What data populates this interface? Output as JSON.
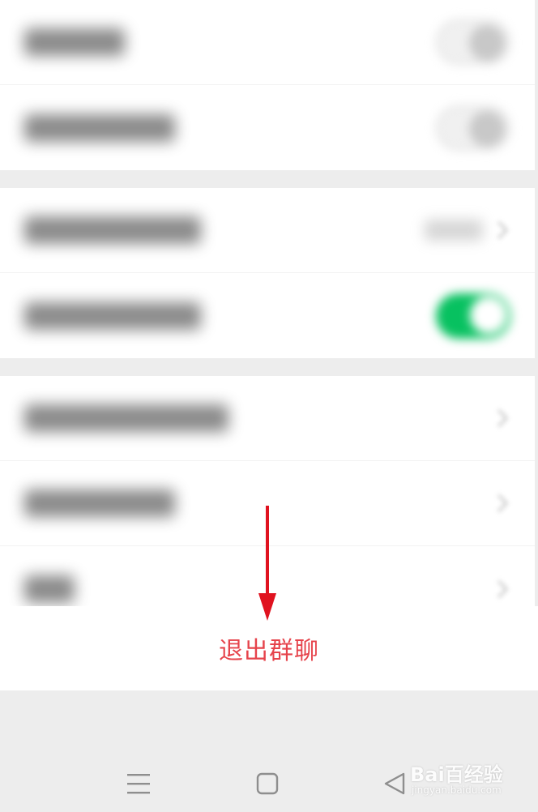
{
  "settings": {
    "group1": [
      {
        "control": "toggle",
        "state": "off"
      },
      {
        "control": "toggle",
        "state": "off"
      }
    ],
    "group2": [
      {
        "control": "value-chevron"
      },
      {
        "control": "toggle",
        "state": "on"
      }
    ],
    "group3": [
      {
        "control": "chevron"
      },
      {
        "control": "chevron"
      },
      {
        "control": "chevron"
      }
    ]
  },
  "exit": {
    "label": "退出群聊",
    "color": "#e6434b"
  },
  "colors": {
    "toggle_on": "#07c160",
    "arrow": "#e0121f",
    "background": "#ededed"
  },
  "navbar": {
    "icons": [
      "menu-icon",
      "home-square-icon",
      "back-triangle-icon"
    ]
  },
  "watermark": {
    "main": "Bai百经验",
    "sub": "jingyan.baidu.com"
  }
}
